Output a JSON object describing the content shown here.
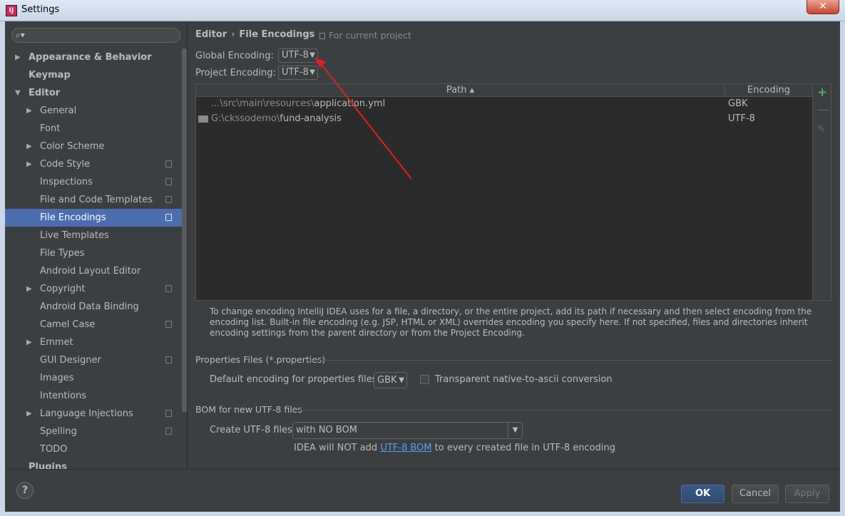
{
  "window": {
    "title": "Settings",
    "close_glyph": "✕"
  },
  "search": {
    "placeholder": ""
  },
  "sidebar": {
    "items": [
      {
        "label": "Appearance & Behavior"
      },
      {
        "label": "Keymap"
      },
      {
        "label": "Editor"
      },
      {
        "label": "General"
      },
      {
        "label": "Font"
      },
      {
        "label": "Color Scheme"
      },
      {
        "label": "Code Style"
      },
      {
        "label": "Inspections"
      },
      {
        "label": "File and Code Templates"
      },
      {
        "label": "File Encodings"
      },
      {
        "label": "Live Templates"
      },
      {
        "label": "File Types"
      },
      {
        "label": "Android Layout Editor"
      },
      {
        "label": "Copyright"
      },
      {
        "label": "Android Data Binding"
      },
      {
        "label": "Camel Case"
      },
      {
        "label": "Emmet"
      },
      {
        "label": "GUI Designer"
      },
      {
        "label": "Images"
      },
      {
        "label": "Intentions"
      },
      {
        "label": "Language Injections"
      },
      {
        "label": "Spelling"
      },
      {
        "label": "TODO"
      },
      {
        "label": "Plugins"
      }
    ]
  },
  "breadcrumb": {
    "parent": "Editor",
    "separator": "›",
    "current": "File Encodings"
  },
  "project_note": "For current project",
  "global_encoding": {
    "label": "Global Encoding:",
    "value": "UTF-8"
  },
  "project_encoding": {
    "label": "Project Encoding:",
    "value": "UTF-8"
  },
  "table": {
    "columns": {
      "path": "Path ▴",
      "encoding": "Encoding"
    },
    "rows": [
      {
        "path_dim": "...\\src\\main\\resources\\",
        "path_name": "application.yml",
        "encoding": "GBK"
      },
      {
        "path_dim": "G:\\ckssodemo\\",
        "path_name": "fund-analysis",
        "encoding": "UTF-8"
      }
    ]
  },
  "note": "To change encoding IntelliJ IDEA uses for a file, a directory, or the entire project, add its path if necessary and then select encoding from the encoding list. Built-in file encoding (e.g. JSP, HTML or XML) overrides encoding you specify here. If not specified, files and directories inherit encoding settings from the parent directory or from the Project Encoding.",
  "properties": {
    "section_title": "Properties Files (*.properties)",
    "default_label": "Default encoding for properties files:",
    "default_value": "GBK",
    "transparent_label": "Transparent native-to-ascii conversion"
  },
  "bom": {
    "section_title": "BOM for new UTF-8 files",
    "create_label": "Create UTF-8 files:",
    "create_value": "with NO BOM",
    "info_before": "IDEA will NOT add ",
    "info_link": "UTF-8 BOM",
    "info_after": " to every created file in UTF-8 encoding"
  },
  "buttons": {
    "help": "?",
    "ok": "OK",
    "cancel": "Cancel",
    "apply": "Apply"
  },
  "colors": {
    "selection": "#4b6eaf",
    "annotation_arrow": "#e02020",
    "add_green": "#59a869",
    "link": "#589df6"
  }
}
